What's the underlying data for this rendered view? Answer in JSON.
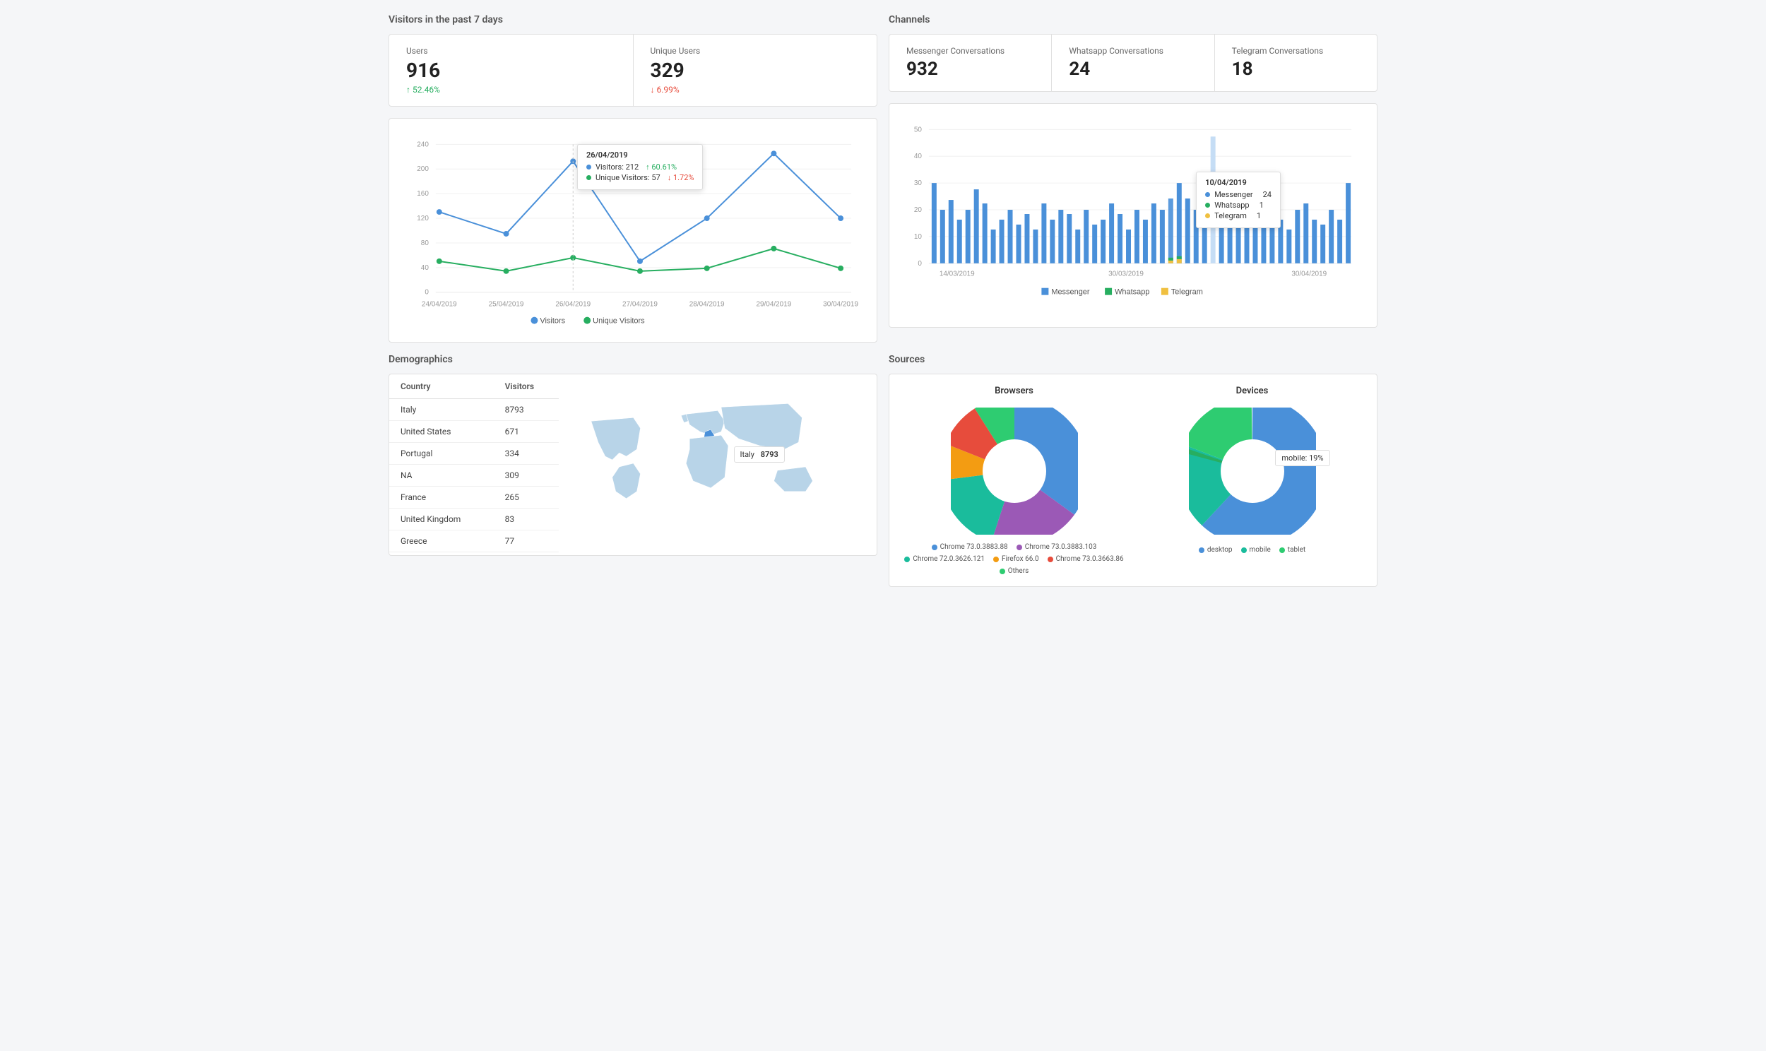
{
  "header": {
    "visitors_title": "Visitors in the past 7 days"
  },
  "visitor_cards": [
    {
      "label": "Users",
      "value": "916",
      "change": "↑ 52.46%",
      "direction": "up"
    },
    {
      "label": "Unique Users",
      "value": "329",
      "change": "↓ 6.99%",
      "direction": "down"
    }
  ],
  "line_chart": {
    "dates": [
      "24/04/2019",
      "25/04/2019",
      "26/04/2019",
      "27/04/2019",
      "28/04/2019",
      "29/04/2019",
      "30/04/2019"
    ],
    "visitors": [
      130,
      95,
      212,
      50,
      120,
      225,
      120
    ],
    "unique_visitors": [
      50,
      35,
      57,
      35,
      40,
      75,
      40
    ],
    "tooltip": {
      "date": "26/04/2019",
      "visitors": "Visitors: 212",
      "visitors_change": "↑ 60.61%",
      "unique": "Unique Visitors: 57",
      "unique_change": "↓ 1.72%"
    },
    "legend_visitors": "Visitors",
    "legend_unique": "Unique Visitors",
    "y_labels": [
      "0",
      "40",
      "80",
      "120",
      "160",
      "200",
      "240"
    ]
  },
  "channels": {
    "title": "Channels",
    "cards": [
      {
        "label": "Messenger Conversations",
        "value": "932"
      },
      {
        "label": "Whatsapp Conversations",
        "value": "24"
      },
      {
        "label": "Telegram Conversations",
        "value": "18"
      }
    ]
  },
  "bar_chart": {
    "x_labels": [
      "14/03/2019",
      "30/03/2019",
      "30/04/2019"
    ],
    "y_labels": [
      "0",
      "10",
      "20",
      "30",
      "40",
      "50"
    ],
    "tooltip": {
      "date": "10/04/2019",
      "messenger": 24,
      "whatsapp": 1,
      "telegram": 1
    },
    "legend": [
      "Messenger",
      "Whatsapp",
      "Telegram"
    ],
    "colors": {
      "messenger": "#4a90d9",
      "whatsapp": "#27ae60",
      "telegram": "#f0c040"
    }
  },
  "demographics": {
    "title": "Demographics",
    "table_headers": [
      "Country",
      "Visitors"
    ],
    "rows": [
      {
        "country": "Italy",
        "visitors": "8793"
      },
      {
        "country": "United States",
        "visitors": "671"
      },
      {
        "country": "Portugal",
        "visitors": "334"
      },
      {
        "country": "NA",
        "visitors": "309"
      },
      {
        "country": "France",
        "visitors": "265"
      },
      {
        "country": "United Kingdom",
        "visitors": "83"
      },
      {
        "country": "Greece",
        "visitors": "77"
      }
    ],
    "map_tooltip": {
      "country": "Italy",
      "value": "8793"
    }
  },
  "sources": {
    "title": "Sources",
    "browsers": {
      "title": "Browsers",
      "slices": [
        {
          "label": "Chrome 73.0.3883.88",
          "value": 35,
          "color": "#4a90d9"
        },
        {
          "label": "Chrome 73.0.3883.103",
          "value": 20,
          "color": "#9b59b6"
        },
        {
          "label": "Chrome 72.0.3626.121",
          "value": 18,
          "color": "#1abc9c"
        },
        {
          "label": "Firefox 66.0",
          "value": 8,
          "color": "#f39c12"
        },
        {
          "label": "Chrome 73.0.3663.86",
          "value": 10,
          "color": "#e74c3c"
        },
        {
          "label": "Others",
          "value": 9,
          "color": "#2ecc71"
        }
      ]
    },
    "devices": {
      "title": "Devices",
      "slices": [
        {
          "label": "desktop",
          "value": 62,
          "color": "#4a90d9"
        },
        {
          "label": "mobile",
          "value": 19,
          "color": "#1abc9c"
        },
        {
          "label": "tablet",
          "value": 19,
          "color": "#2ecc71"
        }
      ],
      "tooltip": "mobile: 19%"
    }
  }
}
